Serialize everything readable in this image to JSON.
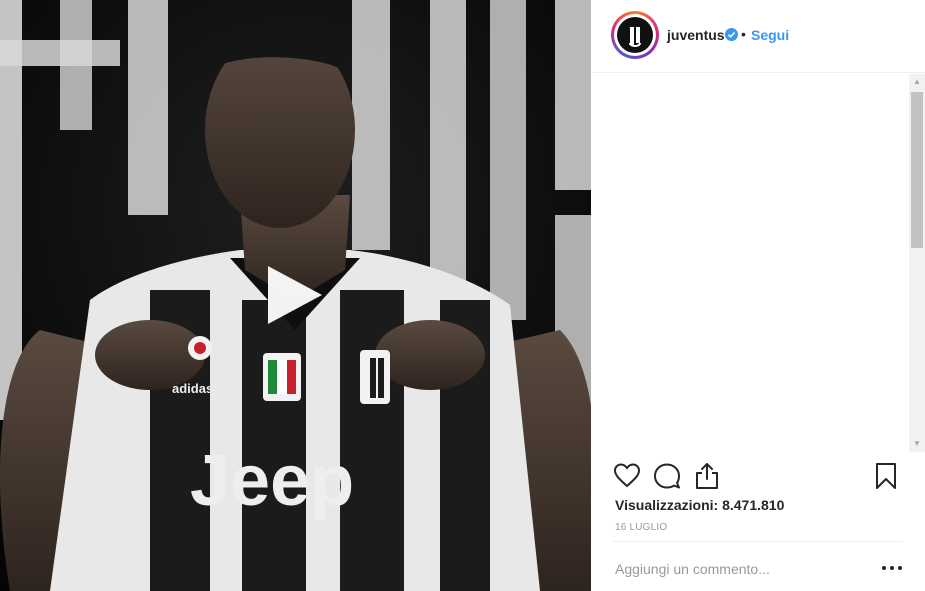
{
  "post": {
    "media_type": "video",
    "play_icon": "play-icon",
    "jersey_sponsor": "Jeep",
    "kit_brand": "adidas",
    "account": {
      "username": "juventus",
      "verified": true,
      "verified_icon": "verified-badge-icon",
      "separator": "•",
      "follow_label": "Segui"
    },
    "actions": {
      "like_icon": "heart-icon",
      "comment_icon": "comment-icon",
      "share_icon": "share-icon",
      "save_icon": "bookmark-icon"
    },
    "views_text": "Visualizzazioni: 8.471.810",
    "date": "16 LUGLIO",
    "comment_box": {
      "placeholder": "Aggiungi un commento...",
      "options_icon": "more-options-icon"
    }
  },
  "colors": {
    "link_blue": "#3897f0",
    "text": "#262626",
    "muted": "#999999",
    "border": "#efefef"
  }
}
